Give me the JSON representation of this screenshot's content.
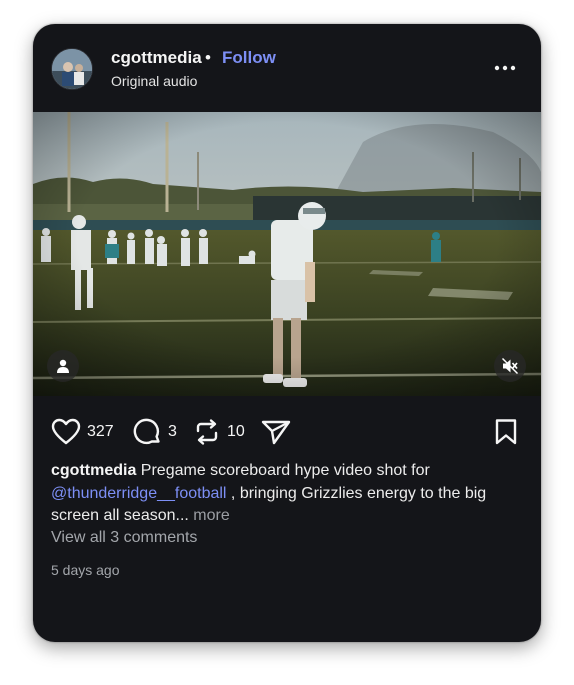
{
  "post": {
    "username": "cgottmedia",
    "separator": "•",
    "follow_label": "Follow",
    "audio_label": "Original audio"
  },
  "icons": {
    "more": "more-horizontal-icon",
    "user_tag": "user-icon",
    "mute": "speaker-muted-icon",
    "like": "heart-icon",
    "comment": "comment-bubble-icon",
    "repost": "repost-icon",
    "share": "send-paper-plane-icon",
    "save": "bookmark-icon"
  },
  "stats": {
    "likes": "327",
    "comments": "3",
    "reposts": "10"
  },
  "caption": {
    "username": "cgottmedia",
    "text_before": " Pregame scoreboard hype video shot for ",
    "mention": "@thunderridge__football",
    "text_after": " , bringing Grizzlies energy to the big screen all season...",
    "more_label": " more"
  },
  "view_comments": "View all 3 comments",
  "timestamp": "5 days ago",
  "colors": {
    "background": "#141519",
    "accent": "#7d8ff5",
    "text": "#f4f4f5",
    "muted": "#a3a6ab"
  }
}
